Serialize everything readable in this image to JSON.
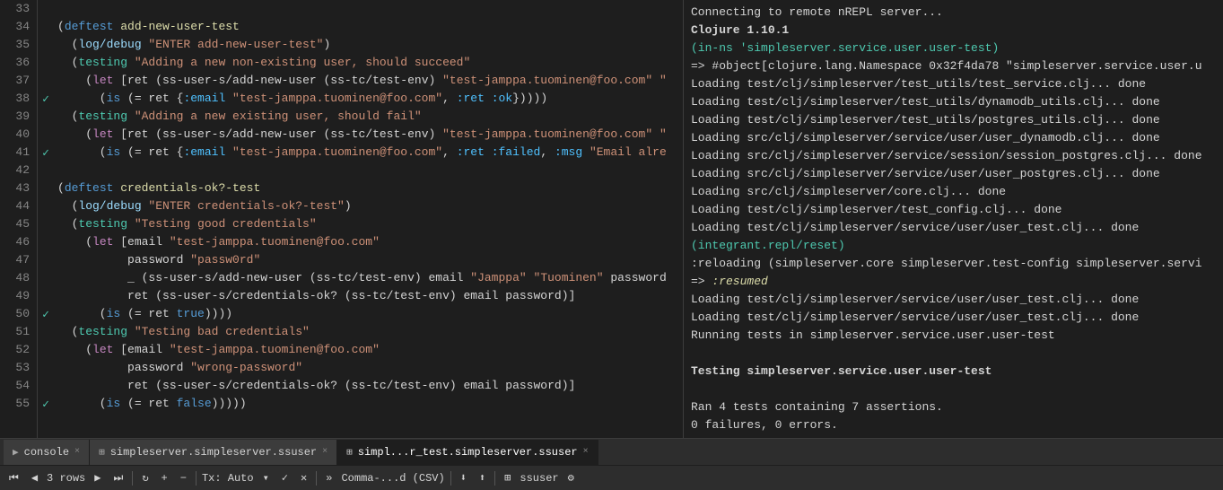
{
  "editor": {
    "lines": [
      {
        "num": 33,
        "gutter": "",
        "content": []
      },
      {
        "num": 34,
        "gutter": "",
        "content": [
          {
            "t": "(",
            "c": "c-paren"
          },
          {
            "t": "deftest ",
            "c": "c-deftest"
          },
          {
            "t": "add-new-user-test",
            "c": "c-fn-name"
          }
        ]
      },
      {
        "num": 35,
        "gutter": "",
        "content": [
          {
            "t": "  (",
            "c": "c-paren"
          },
          {
            "t": "log/debug ",
            "c": "c-log"
          },
          {
            "t": "\"ENTER add-new-user-test\"",
            "c": "c-string"
          },
          {
            "t": ")",
            "c": "c-paren"
          }
        ]
      },
      {
        "num": 36,
        "gutter": "",
        "content": [
          {
            "t": "  (",
            "c": "c-paren"
          },
          {
            "t": "testing ",
            "c": "c-testing"
          },
          {
            "t": "\"Adding a new non-existing user, should succeed\"",
            "c": "c-string"
          }
        ]
      },
      {
        "num": 37,
        "gutter": "",
        "content": [
          {
            "t": "    (",
            "c": "c-paren"
          },
          {
            "t": "let ",
            "c": "c-let"
          },
          {
            "t": "[ret (ss-user-s/add-new-user (ss-tc/test-env) ",
            "c": "c-white"
          },
          {
            "t": "\"test-jamppa.tuominen@foo.com\"",
            "c": "c-string"
          },
          {
            "t": " \"",
            "c": "c-string"
          }
        ]
      },
      {
        "num": 38,
        "gutter": "check",
        "content": [
          {
            "t": "      (",
            "c": "c-paren"
          },
          {
            "t": "is ",
            "c": "c-keyword"
          },
          {
            "t": "(= ret {",
            "c": "c-white"
          },
          {
            "t": ":email ",
            "c": "c-symbol"
          },
          {
            "t": "\"test-jamppa.tuominen@foo.com\"",
            "c": "c-string"
          },
          {
            "t": ", ",
            "c": "c-white"
          },
          {
            "t": ":ret :ok",
            "c": "c-symbol"
          },
          {
            "t": "}))))",
            "c": "c-white"
          }
        ]
      },
      {
        "num": 39,
        "gutter": "",
        "content": [
          {
            "t": "  (",
            "c": "c-paren"
          },
          {
            "t": "testing ",
            "c": "c-testing"
          },
          {
            "t": "\"Adding a new existing user, should fail\"",
            "c": "c-string"
          }
        ]
      },
      {
        "num": 40,
        "gutter": "",
        "content": [
          {
            "t": "    (",
            "c": "c-paren"
          },
          {
            "t": "let ",
            "c": "c-let"
          },
          {
            "t": "[ret (ss-user-s/add-new-user (ss-tc/test-env) ",
            "c": "c-white"
          },
          {
            "t": "\"test-jamppa.tuominen@foo.com\"",
            "c": "c-string"
          },
          {
            "t": " \"",
            "c": "c-string"
          }
        ]
      },
      {
        "num": 41,
        "gutter": "check",
        "content": [
          {
            "t": "      (",
            "c": "c-paren"
          },
          {
            "t": "is ",
            "c": "c-keyword"
          },
          {
            "t": "(= ret {",
            "c": "c-white"
          },
          {
            "t": ":email ",
            "c": "c-symbol"
          },
          {
            "t": "\"test-jamppa.tuominen@foo.com\"",
            "c": "c-string"
          },
          {
            "t": ", ",
            "c": "c-white"
          },
          {
            "t": ":ret :failed",
            "c": "c-symbol"
          },
          {
            "t": ", ",
            "c": "c-white"
          },
          {
            "t": ":msg ",
            "c": "c-symbol"
          },
          {
            "t": "\"Email alre",
            "c": "c-string"
          }
        ]
      },
      {
        "num": 42,
        "gutter": "",
        "content": []
      },
      {
        "num": 43,
        "gutter": "",
        "content": [
          {
            "t": "(",
            "c": "c-paren"
          },
          {
            "t": "deftest ",
            "c": "c-deftest"
          },
          {
            "t": "credentials-ok?-test",
            "c": "c-fn-name"
          }
        ]
      },
      {
        "num": 44,
        "gutter": "",
        "content": [
          {
            "t": "  (",
            "c": "c-paren"
          },
          {
            "t": "log/debug ",
            "c": "c-log"
          },
          {
            "t": "\"ENTER credentials-ok?-test\"",
            "c": "c-string"
          },
          {
            "t": ")",
            "c": "c-paren"
          }
        ]
      },
      {
        "num": 45,
        "gutter": "",
        "content": [
          {
            "t": "  (",
            "c": "c-paren"
          },
          {
            "t": "testing ",
            "c": "c-testing"
          },
          {
            "t": "\"Testing good credentials\"",
            "c": "c-string"
          }
        ]
      },
      {
        "num": 46,
        "gutter": "",
        "content": [
          {
            "t": "    (",
            "c": "c-paren"
          },
          {
            "t": "let ",
            "c": "c-let"
          },
          {
            "t": "[email ",
            "c": "c-white"
          },
          {
            "t": "\"test-jamppa.tuominen@foo.com\"",
            "c": "c-string"
          }
        ]
      },
      {
        "num": 47,
        "gutter": "",
        "content": [
          {
            "t": "          password ",
            "c": "c-white"
          },
          {
            "t": "\"passw0rd\"",
            "c": "c-string"
          }
        ]
      },
      {
        "num": 48,
        "gutter": "",
        "content": [
          {
            "t": "          _ (ss-user-s/add-new-user (ss-tc/test-env) email ",
            "c": "c-white"
          },
          {
            "t": "\"Jamppa\"",
            "c": "c-string"
          },
          {
            "t": " ",
            "c": "c-white"
          },
          {
            "t": "\"Tuominen\"",
            "c": "c-string"
          },
          {
            "t": " password",
            "c": "c-white"
          }
        ]
      },
      {
        "num": 49,
        "gutter": "",
        "content": [
          {
            "t": "          ret (ss-user-s/credentials-ok? (ss-tc/test-env) email password)]",
            "c": "c-white"
          }
        ]
      },
      {
        "num": 50,
        "gutter": "check",
        "content": [
          {
            "t": "      (",
            "c": "c-paren"
          },
          {
            "t": "is ",
            "c": "c-keyword"
          },
          {
            "t": "(= ret ",
            "c": "c-white"
          },
          {
            "t": "true",
            "c": "c-bool"
          },
          {
            "t": "))))",
            "c": "c-white"
          }
        ]
      },
      {
        "num": 51,
        "gutter": "",
        "content": [
          {
            "t": "  (",
            "c": "c-paren"
          },
          {
            "t": "testing ",
            "c": "c-testing"
          },
          {
            "t": "\"Testing bad credentials\"",
            "c": "c-string"
          }
        ]
      },
      {
        "num": 52,
        "gutter": "",
        "content": [
          {
            "t": "    (",
            "c": "c-paren"
          },
          {
            "t": "let ",
            "c": "c-let"
          },
          {
            "t": "[email ",
            "c": "c-white"
          },
          {
            "t": "\"test-jamppa.tuominen@foo.com\"",
            "c": "c-string"
          }
        ]
      },
      {
        "num": 53,
        "gutter": "",
        "content": [
          {
            "t": "          password ",
            "c": "c-white"
          },
          {
            "t": "\"wrong-password\"",
            "c": "c-string"
          }
        ]
      },
      {
        "num": 54,
        "gutter": "",
        "content": [
          {
            "t": "          ret (ss-user-s/credentials-ok? (ss-tc/test-env) email password)]",
            "c": "c-white"
          }
        ]
      },
      {
        "num": 55,
        "gutter": "check",
        "content": [
          {
            "t": "      (",
            "c": "c-paren"
          },
          {
            "t": "is ",
            "c": "c-keyword"
          },
          {
            "t": "(= ret ",
            "c": "c-white"
          },
          {
            "t": "false",
            "c": "c-bool"
          },
          {
            "t": ")))))",
            "c": "c-white"
          }
        ]
      }
    ]
  },
  "repl": {
    "lines": [
      {
        "text": "Connecting to remote nREPL server...",
        "class": "c-white"
      },
      {
        "text": "Clojure 1.10.1",
        "class": "c-bold"
      },
      {
        "text": "(in-ns 'simpleserver.service.user.user-test)",
        "class": "c-ns"
      },
      {
        "text": "=> #object[clojure.lang.Namespace 0x32f4da78 \"simpleserver.service.user.u",
        "class": "c-white"
      },
      {
        "text": "Loading test/clj/simpleserver/test_utils/test_service.clj... done",
        "class": "c-white"
      },
      {
        "text": "Loading test/clj/simpleserver/test_utils/dynamodb_utils.clj... done",
        "class": "c-white"
      },
      {
        "text": "Loading test/clj/simpleserver/test_utils/postgres_utils.clj... done",
        "class": "c-white"
      },
      {
        "text": "Loading src/clj/simpleserver/service/user/user_dynamodb.clj... done",
        "class": "c-white"
      },
      {
        "text": "Loading src/clj/simpleserver/service/session/session_postgres.clj... done",
        "class": "c-white"
      },
      {
        "text": "Loading src/clj/simpleserver/service/user/user_postgres.clj... done",
        "class": "c-white"
      },
      {
        "text": "Loading src/clj/simpleserver/core.clj... done",
        "class": "c-white"
      },
      {
        "text": "Loading test/clj/simpleserver/test_config.clj... done",
        "class": "c-white"
      },
      {
        "text": "Loading test/clj/simpleserver/service/user/user_test.clj... done",
        "class": "c-white"
      },
      {
        "text": "(integrant.repl/reset)",
        "class": "c-ns"
      },
      {
        "text": ":reloading (simpleserver.core simpleserver.test-config simpleserver.servi",
        "class": "c-white"
      },
      {
        "text": "=> :resumed",
        "class": "c-resumed"
      },
      {
        "text": "Loading test/clj/simpleserver/service/user/user_test.clj... done",
        "class": "c-white"
      },
      {
        "text": "Loading test/clj/simpleserver/service/user/user_test.clj... done",
        "class": "c-white"
      },
      {
        "text": "Running tests in simpleserver.service.user.user-test",
        "class": "c-white"
      },
      {
        "text": "",
        "class": ""
      },
      {
        "text": "Testing simpleserver.service.user.user-test",
        "class": "c-bold"
      },
      {
        "text": "",
        "class": ""
      },
      {
        "text": "Ran 4 tests containing 7 assertions.",
        "class": "c-white"
      },
      {
        "text": "0 failures, 0 errors.",
        "class": "c-white"
      }
    ]
  },
  "tabs": [
    {
      "label": "console",
      "icon": "console",
      "active": false,
      "closable": true
    },
    {
      "label": "simpleserver.simpleserver.ssuser",
      "icon": "table",
      "active": false,
      "closable": true
    },
    {
      "label": "simpl...r_test.simpleserver.ssuser",
      "icon": "table",
      "active": true,
      "closable": true
    }
  ],
  "toolbar": {
    "rows_label": "3 rows",
    "tx_label": "Tx: Auto",
    "format_label": "Comma-...d (CSV)",
    "user_label": "ssuser",
    "buttons": [
      "prev",
      "next",
      "first",
      "last",
      "refresh",
      "add",
      "remove",
      "settings"
    ]
  }
}
